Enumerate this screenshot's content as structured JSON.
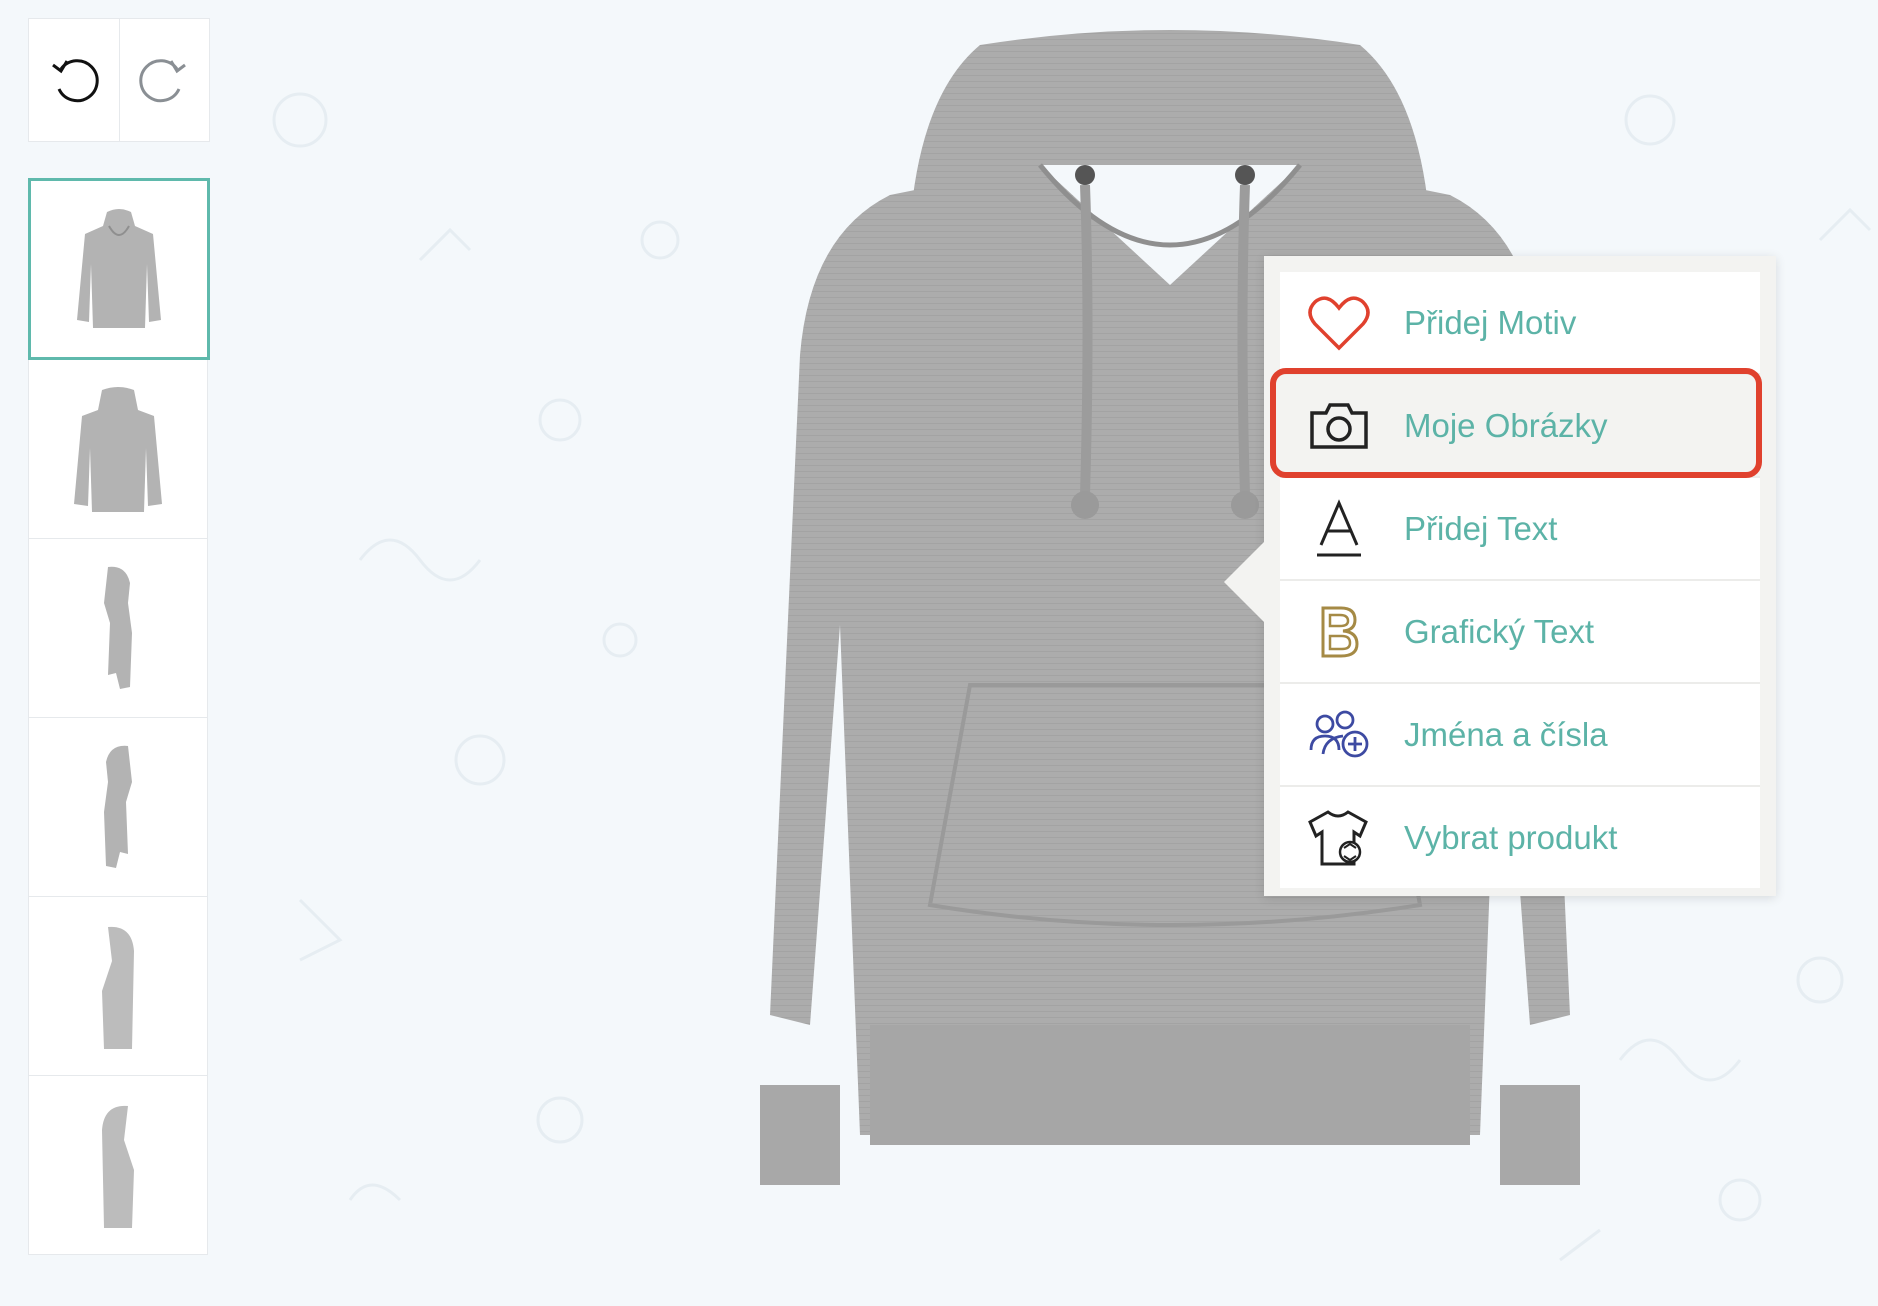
{
  "toolbar": {
    "undo_icon": "undo-icon",
    "redo_icon": "redo-icon"
  },
  "views": [
    {
      "name": "front",
      "icon": "hoodie-front-thumbnail",
      "active": true
    },
    {
      "name": "back",
      "icon": "hoodie-back-thumbnail",
      "active": false
    },
    {
      "name": "right-side",
      "icon": "hoodie-right-side-thumbnail",
      "active": false
    },
    {
      "name": "left-side",
      "icon": "hoodie-left-side-thumbnail",
      "active": false
    },
    {
      "name": "right-sleeve",
      "icon": "hoodie-right-sleeve-thumbnail",
      "active": false
    },
    {
      "name": "left-sleeve",
      "icon": "hoodie-left-sleeve-thumbnail",
      "active": false
    }
  ],
  "product": {
    "color": "#a9a9a9"
  },
  "menu": {
    "items": [
      {
        "label": "Přidej Motiv",
        "icon": "heart-icon",
        "icon_color": "#e0412e"
      },
      {
        "label": "Moje Obrázky",
        "icon": "camera-icon",
        "icon_color": "#222222",
        "highlighted": true
      },
      {
        "label": "Přidej Text",
        "icon": "text-a-icon",
        "icon_color": "#222222"
      },
      {
        "label": "Grafický Text",
        "icon": "graphic-b-icon",
        "icon_color": "#a58a45"
      },
      {
        "label": "Jména a čísla",
        "icon": "names-numbers-icon",
        "icon_color": "#3d4aa2"
      },
      {
        "label": "Vybrat produkt",
        "icon": "change-product-icon",
        "icon_color": "#222222"
      }
    ],
    "label_color": "#5cb3a7",
    "highlight_color": "#e0412e"
  }
}
